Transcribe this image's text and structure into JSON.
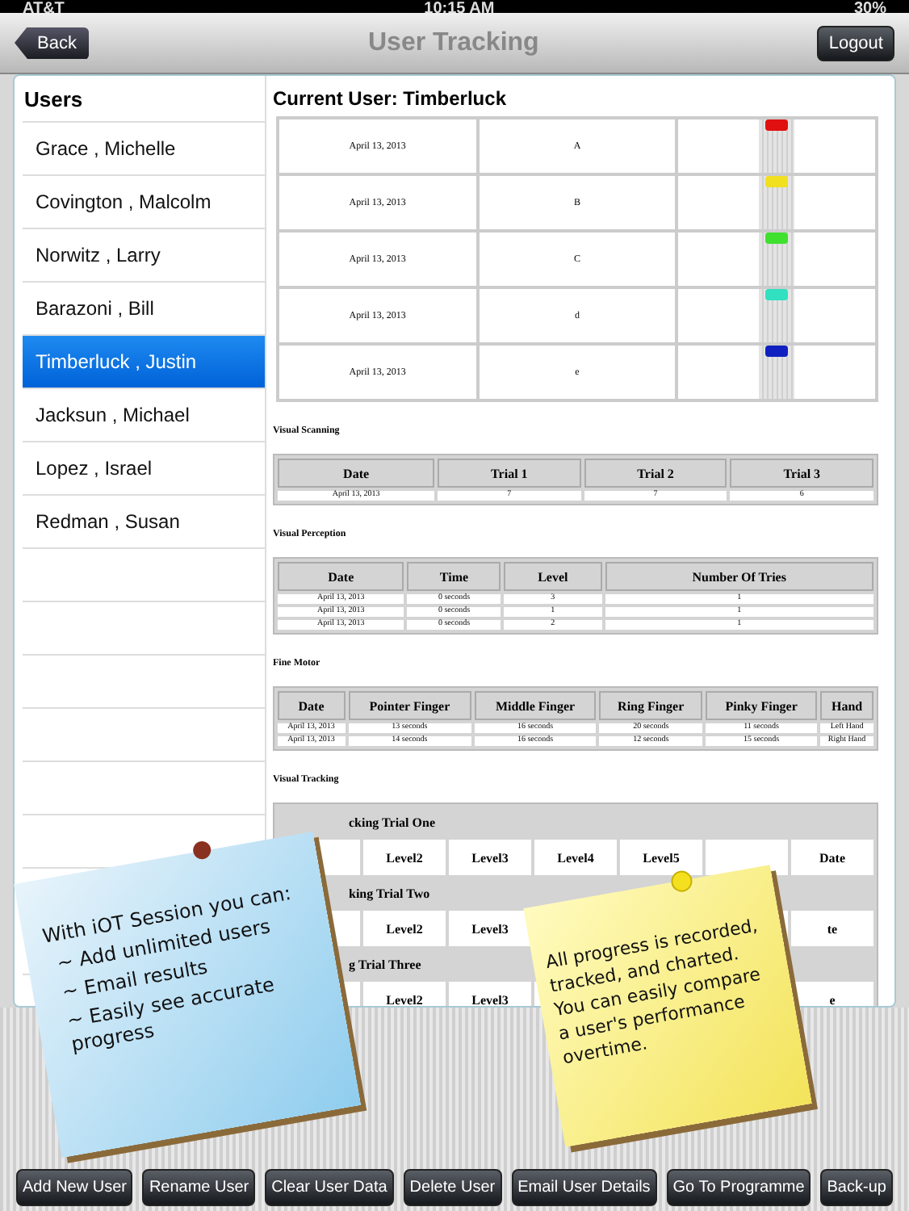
{
  "status_bar": {
    "carrier": "AT&T",
    "time": "10:15 AM",
    "battery": "30%"
  },
  "nav": {
    "back": "Back",
    "title": "User Tracking",
    "logout": "Logout"
  },
  "users": {
    "title": "Users",
    "items": [
      {
        "name": "Grace , Michelle",
        "selected": false
      },
      {
        "name": "Covington , Malcolm",
        "selected": false
      },
      {
        "name": "Norwitz , Larry",
        "selected": false
      },
      {
        "name": "Barazoni , Bill",
        "selected": false
      },
      {
        "name": "Timberluck , Justin",
        "selected": true
      },
      {
        "name": "Jacksun , Michael",
        "selected": false
      },
      {
        "name": "Lopez , Israel",
        "selected": false
      },
      {
        "name": "Redman , Susan",
        "selected": false
      }
    ]
  },
  "current_user": "Current User: Timberluck",
  "letters": {
    "rows": [
      {
        "date": "April 13, 2013",
        "letter": "A",
        "color": "#e01010"
      },
      {
        "date": "April 13, 2013",
        "letter": "B",
        "color": "#f0e020"
      },
      {
        "date": "April 13, 2013",
        "letter": "C",
        "color": "#40e030"
      },
      {
        "date": "April 13, 2013",
        "letter": "d",
        "color": "#30e0c0"
      },
      {
        "date": "April 13, 2013",
        "letter": "e",
        "color": "#1020c0"
      }
    ]
  },
  "sections": [
    {
      "title": "Visual Scanning",
      "columns": [
        "Date",
        "Trial 1",
        "Trial 2",
        "Trial 3"
      ],
      "rows": [
        [
          "April 13, 2013",
          "7",
          "7",
          "6"
        ]
      ]
    },
    {
      "title": "Visual Perception",
      "columns": [
        "Date",
        "Time",
        "Level",
        "Number Of Tries"
      ],
      "rows": [
        [
          "April 13, 2013",
          "0 seconds",
          "3",
          "1"
        ],
        [
          "April 13, 2013",
          "0 seconds",
          "1",
          "1"
        ],
        [
          "April 13, 2013",
          "0 seconds",
          "2",
          "1"
        ]
      ]
    },
    {
      "title": "Fine Motor",
      "columns": [
        "Date",
        "Pointer Finger",
        "Middle Finger",
        "Ring Finger",
        "Pinky Finger",
        "Hand"
      ],
      "rows": [
        [
          "April 13, 2013",
          "13 seconds",
          "16 seconds",
          "20 seconds",
          "11 seconds",
          "Left Hand"
        ],
        [
          "April 13, 2013",
          "14 seconds",
          "16 seconds",
          "12 seconds",
          "15 seconds",
          "Right Hand"
        ]
      ]
    }
  ],
  "visual_tracking": {
    "title": "Visual Tracking",
    "trials": [
      {
        "title": "cking Trial One",
        "cells": [
          null,
          "Level2",
          "Level3",
          "Level4",
          "Level5",
          null,
          "Date"
        ]
      },
      {
        "title": "king Trial Two",
        "cells": [
          null,
          "Level2",
          "Level3",
          null,
          null,
          null,
          "te"
        ]
      },
      {
        "title": "g Trial Three",
        "cells": [
          null,
          "Level2",
          "Level3",
          null,
          null,
          null,
          "e"
        ]
      }
    ]
  },
  "notes": [
    {
      "kind": "blue",
      "heading": "With iOT Session you can:",
      "items": [
        "~ Add unlimited users",
        "~ Email results",
        "~ Easily see accurate progress"
      ]
    },
    {
      "kind": "yellow",
      "text": "All progress is recorded, tracked, and charted.  You can easily compare a user's performance overtime."
    }
  ],
  "buttons": [
    "Add New User",
    "Rename User",
    "Clear User Data",
    "Delete User",
    "Email User Details",
    "Go To Programme",
    "Back-up"
  ]
}
